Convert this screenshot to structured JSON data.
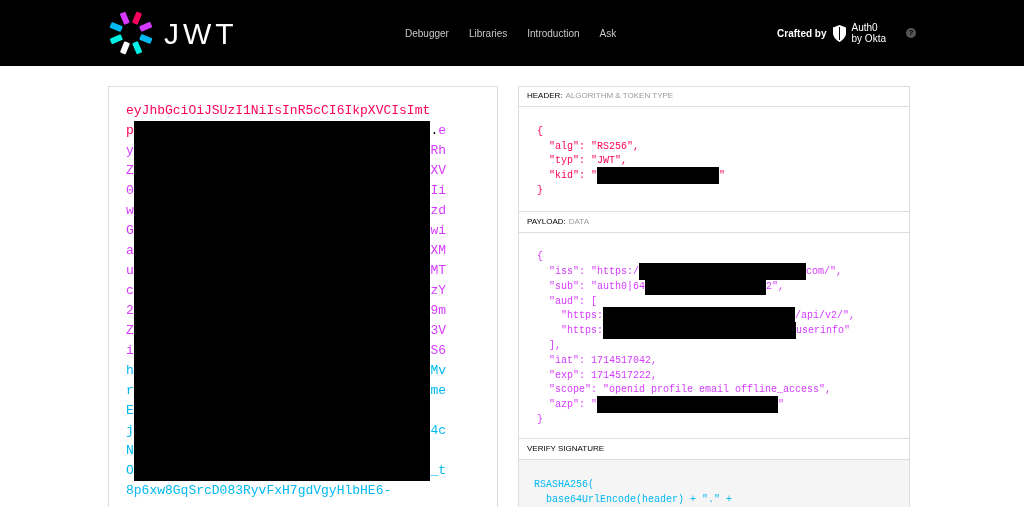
{
  "brand": {
    "name": "JWT"
  },
  "nav": [
    {
      "label": "Debugger"
    },
    {
      "label": "Libraries"
    },
    {
      "label": "Introduction"
    },
    {
      "label": "Ask"
    }
  ],
  "credit": {
    "label": "Crafted by",
    "brand_line_1": "Auth0",
    "brand_line_2": "by Okta",
    "help": "?"
  },
  "encoded": {
    "lines": [
      {
        "start": [
          {
            "kind": "header",
            "text": "eyJhbGciOiJSUzI1NiIsInR5cCI6IkpXVCIsImt"
          }
        ]
      },
      {
        "start": [
          {
            "kind": "header",
            "text": "p"
          }
        ],
        "end": [
          {
            "kind": "dot",
            "text": "."
          },
          {
            "kind": "payload",
            "text": "e"
          }
        ]
      },
      {
        "start": [
          {
            "kind": "payload",
            "text": "y"
          }
        ],
        "end": [
          {
            "kind": "payload",
            "text": "Rh"
          }
        ]
      },
      {
        "start": [
          {
            "kind": "payload",
            "text": "Z"
          }
        ],
        "end": [
          {
            "kind": "payload",
            "text": "XV"
          }
        ]
      },
      {
        "start": [
          {
            "kind": "payload",
            "text": "0"
          }
        ],
        "end": [
          {
            "kind": "payload",
            "text": "Ii"
          }
        ]
      },
      {
        "start": [
          {
            "kind": "payload",
            "text": "w"
          }
        ],
        "end": [
          {
            "kind": "payload",
            "text": "zd"
          }
        ]
      },
      {
        "start": [
          {
            "kind": "payload",
            "text": "G"
          }
        ],
        "end": [
          {
            "kind": "payload",
            "text": "wi"
          }
        ]
      },
      {
        "start": [
          {
            "kind": "payload",
            "text": "a"
          }
        ],
        "end": [
          {
            "kind": "payload",
            "text": "XM"
          }
        ]
      },
      {
        "start": [
          {
            "kind": "payload",
            "text": "u"
          }
        ],
        "end": [
          {
            "kind": "payload",
            "text": "MT"
          }
        ]
      },
      {
        "start": [
          {
            "kind": "payload",
            "text": "c"
          }
        ],
        "end": [
          {
            "kind": "payload",
            "text": "zY"
          }
        ]
      },
      {
        "start": [
          {
            "kind": "payload",
            "text": "2"
          }
        ],
        "end": [
          {
            "kind": "payload",
            "text": "9m"
          }
        ]
      },
      {
        "start": [
          {
            "kind": "payload",
            "text": "Z"
          }
        ],
        "end": [
          {
            "kind": "payload",
            "text": "3V"
          }
        ]
      },
      {
        "start": [
          {
            "kind": "payload",
            "text": "i"
          }
        ],
        "end": [
          {
            "kind": "payload",
            "text": "S6"
          }
        ]
      },
      {
        "start": [
          {
            "kind": "signature",
            "text": "h"
          }
        ],
        "end": [
          {
            "kind": "signature",
            "text": "Mv"
          }
        ]
      },
      {
        "start": [
          {
            "kind": "signature",
            "text": "r"
          }
        ],
        "end": [
          {
            "kind": "signature",
            "text": "me"
          }
        ]
      },
      {
        "start": [
          {
            "kind": "signature",
            "text": "E"
          }
        ]
      },
      {
        "start": [
          {
            "kind": "signature",
            "text": "j"
          }
        ],
        "end": [
          {
            "kind": "signature",
            "text": "4c"
          }
        ]
      },
      {
        "start": [
          {
            "kind": "signature",
            "text": "N"
          }
        ]
      },
      {
        "start": [
          {
            "kind": "signature",
            "text": "O"
          }
        ],
        "end": [
          {
            "kind": "signature",
            "text": "_t"
          }
        ]
      },
      {
        "start": [
          {
            "kind": "signature",
            "text": "8p6xw8GqSrcD083RyvFxH7gdVgyHlbHE6-"
          }
        ]
      }
    ]
  },
  "header_section": {
    "title": "HEADER:",
    "subtitle": "ALGORITHM & TOKEN TYPE",
    "lines": [
      [
        {
          "kind": "text",
          "text": "{"
        }
      ],
      [
        {
          "kind": "text",
          "text": "  \"alg\": \"RS256\","
        }
      ],
      [
        {
          "kind": "text",
          "text": "  \"typ\": \"JWT\","
        }
      ],
      [
        {
          "kind": "text",
          "text": "  \"kid\": \""
        },
        {
          "kind": "redaction"
        },
        {
          "kind": "text",
          "text": "\""
        }
      ],
      [
        {
          "kind": "text",
          "text": "}"
        }
      ]
    ]
  },
  "payload_section": {
    "title": "PAYLOAD:",
    "subtitle": "DATA",
    "lines": [
      [
        {
          "kind": "text",
          "text": "{"
        }
      ],
      [
        {
          "kind": "text",
          "text": "  \"iss\": \"https:/"
        },
        {
          "kind": "redaction"
        },
        {
          "kind": "text",
          "text": "com/\","
        }
      ],
      [
        {
          "kind": "text",
          "text": "  \"sub\": \"auth0|64"
        },
        {
          "kind": "redaction"
        },
        {
          "kind": "text",
          "text": "2\","
        }
      ],
      [
        {
          "kind": "text",
          "text": "  \"aud\": ["
        }
      ],
      [
        {
          "kind": "text",
          "text": "    \"https:"
        },
        {
          "kind": "redaction"
        },
        {
          "kind": "text",
          "text": "/api/v2/\","
        }
      ],
      [
        {
          "kind": "text",
          "text": "    \"https:"
        },
        {
          "kind": "redaction"
        },
        {
          "kind": "text",
          "text": "userinfo\""
        }
      ],
      [
        {
          "kind": "text",
          "text": "  ],"
        }
      ],
      [
        {
          "kind": "text",
          "text": "  \"iat\": 1714517042,"
        }
      ],
      [
        {
          "kind": "text",
          "text": "  \"exp\": 1714517222,"
        }
      ],
      [
        {
          "kind": "text",
          "text": "  \"scope\": \"openid profile email offline_access\","
        }
      ],
      [
        {
          "kind": "text",
          "text": "  \"azp\": \""
        },
        {
          "kind": "redaction"
        },
        {
          "kind": "text",
          "text": "\""
        }
      ],
      [
        {
          "kind": "text",
          "text": "}"
        }
      ]
    ]
  },
  "signature_section": {
    "title": "VERIFY SIGNATURE",
    "lines": [
      "RSASHA256(",
      "  base64UrlEncode(header) + \".\" +"
    ]
  }
}
